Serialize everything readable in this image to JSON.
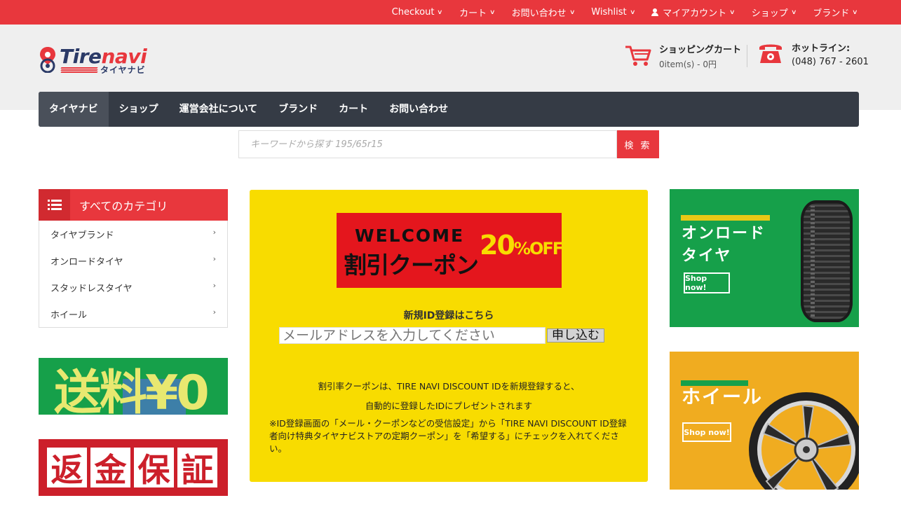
{
  "topnav": {
    "items": [
      "Checkout",
      "カート",
      "お問い合わせ",
      "Wishlist",
      "マイアカウント",
      "ショップ",
      "ブランド"
    ]
  },
  "header": {
    "logo_text_1": "Tire",
    "logo_text_2": "navi",
    "logo_sub": "タイヤナビ",
    "cart_title": "ショッピングカート",
    "cart_summary": "0item(s) - 0円",
    "hotline_title": "ホットライン:",
    "hotline_number": "(048) 767 - 2601"
  },
  "mainnav": {
    "items": [
      "タイヤナビ",
      "ショップ",
      "運営会社について",
      "ブランド",
      "カート",
      "お問い合わせ"
    ]
  },
  "search": {
    "placeholder": "キーワードから探す 195/65r15",
    "button": "検 索"
  },
  "categories": {
    "title": "すべてのカテゴリ",
    "items": [
      "タイヤブランド",
      "オンロードタイヤ",
      "スタッドレスタイヤ",
      "ホイール"
    ]
  },
  "banners": {
    "shipping": "送料¥0",
    "refund": [
      "返",
      "金",
      "保",
      "証"
    ]
  },
  "promo": {
    "coupon_welcome": "WELCOME",
    "coupon_main": "割引クーポン",
    "coupon_pct": "20",
    "coupon_off": "%OFF!",
    "register_title": "新規ID登録はこちら",
    "email_placeholder": "メールアドレスを入力してください",
    "submit": "申し込む",
    "line1": "割引率クーポンは、TIRE NAVI DISCOUNT IDを新規登録すると、",
    "line2": "自動的に登録したIDにプレゼントされます",
    "line3": "※ID登録画面の「メール・クーポンなどの受信設定」から「TIRE NAVI DISCOUNT ID登録者向け特典タイヤナビストアの定期クーポン」を「希望する」にチェックを入れてください。"
  },
  "right_banners": {
    "onroad_title_1": "オンロード",
    "onroad_title_2": "タイヤ",
    "onroad_cta": "Shop now!",
    "wheel_title": "ホイール",
    "wheel_cta": "Shop now!"
  },
  "colors": {
    "accent": "#e8373d",
    "nav_dark": "#353b45",
    "promo_yellow": "#f8dc00",
    "green": "#16a04a",
    "orange": "#f0ac20"
  }
}
